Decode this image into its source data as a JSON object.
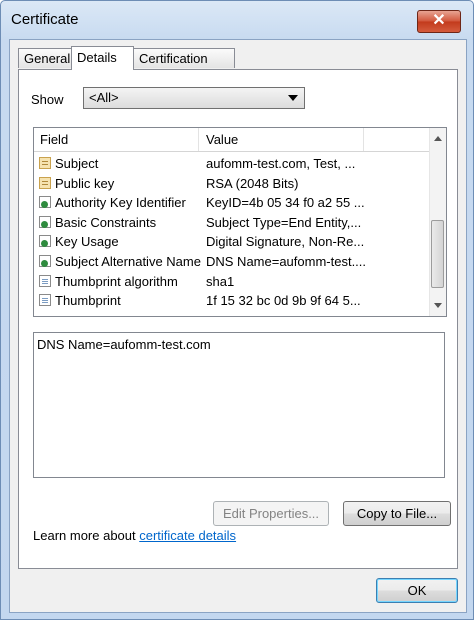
{
  "window": {
    "title": "Certificate",
    "close_label": "✕"
  },
  "tabs": [
    {
      "label": "General",
      "active": false
    },
    {
      "label": "Details",
      "active": true
    },
    {
      "label": "Certification Path",
      "active": false
    }
  ],
  "show": {
    "label": "Show",
    "value": "<All>"
  },
  "fields_list": {
    "columns": [
      "Field",
      "Value"
    ],
    "rows": [
      {
        "icon": "certificate-icon",
        "field": "Subject",
        "value": "aufomm-test.com, Test, ..."
      },
      {
        "icon": "certificate-icon",
        "field": "Public key",
        "value": "RSA (2048 Bits)"
      },
      {
        "icon": "extension-icon",
        "field": "Authority Key Identifier",
        "value": "KeyID=4b 05 34 f0 a2 55 ..."
      },
      {
        "icon": "extension-icon",
        "field": "Basic Constraints",
        "value": "Subject Type=End Entity,..."
      },
      {
        "icon": "extension-icon",
        "field": "Key Usage",
        "value": "Digital Signature, Non-Re..."
      },
      {
        "icon": "extension-icon",
        "field": "Subject Alternative Name",
        "value": "DNS Name=aufomm-test...."
      },
      {
        "icon": "document-icon",
        "field": "Thumbprint algorithm",
        "value": "sha1"
      },
      {
        "icon": "document-icon",
        "field": "Thumbprint",
        "value": "1f 15 32 bc 0d 9b 9f 64 5..."
      }
    ]
  },
  "detail_text": "DNS Name=aufomm-test.com",
  "buttons": {
    "edit_properties": "Edit Properties...",
    "copy_to_file": "Copy to File...",
    "ok": "OK"
  },
  "learn_more": {
    "prefix": "Learn more about ",
    "link": "certificate details"
  }
}
